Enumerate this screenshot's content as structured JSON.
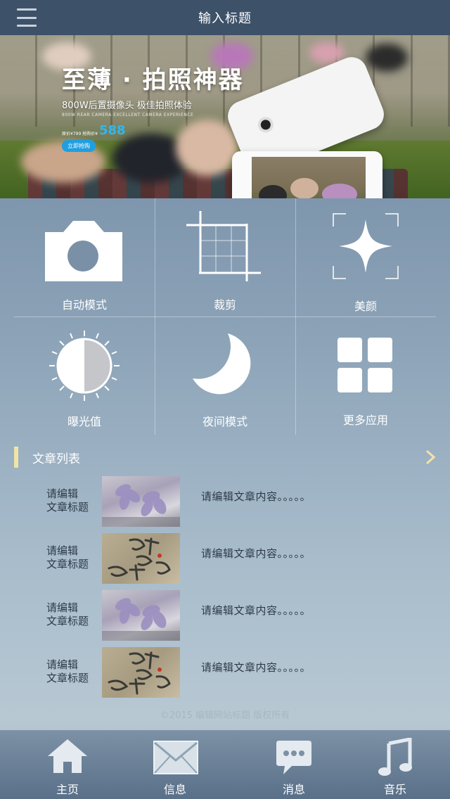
{
  "header": {
    "title": "输入标题",
    "menu_icon": "menu-icon"
  },
  "banner": {
    "headline": "至薄 · 拍照神器",
    "subline": "800W后置摄像头 极佳拍照体验",
    "subline_en": "800W REAR CAMERA EXCELLENT CAMERA EXPERIENCE",
    "price_note": "原价¥799 抢购价¥",
    "price": "588",
    "buy_label": "立即抢购",
    "accent_color": "#2fb7ee"
  },
  "grid": {
    "items": [
      {
        "label": "自动模式",
        "icon": "camera-icon"
      },
      {
        "label": "裁剪",
        "icon": "crop-icon"
      },
      {
        "label": "美颜",
        "icon": "sparkle-icon"
      },
      {
        "label": "曝光值",
        "icon": "exposure-icon"
      },
      {
        "label": "夜间模式",
        "icon": "moon-icon"
      },
      {
        "label": "更多应用",
        "icon": "apps-grid-icon"
      }
    ]
  },
  "articles": {
    "section_title": "文章列表",
    "accent_color": "#f2e3a6",
    "items": [
      {
        "title_line1": "请编辑",
        "title_line2": "文章标题",
        "content": "请编辑文章内容。。。。。",
        "thumb": "flower"
      },
      {
        "title_line1": "请编辑",
        "title_line2": "文章标题",
        "content": "请编辑文章内容。。。。。",
        "thumb": "calligraphy"
      },
      {
        "title_line1": "请编辑",
        "title_line2": "文章标题",
        "content": "请编辑文章内容。。。。。",
        "thumb": "flower"
      },
      {
        "title_line1": "请编辑",
        "title_line2": "文章标题",
        "content": "请编辑文章内容。。。。。",
        "thumb": "calligraphy"
      }
    ]
  },
  "footer": {
    "copyright": "©2015 编辑网站标题 版权所有"
  },
  "tabbar": {
    "tabs": [
      {
        "label": "主页",
        "icon": "home-icon"
      },
      {
        "label": "信息",
        "icon": "envelope-icon"
      },
      {
        "label": "消息",
        "icon": "chat-bubble-icon"
      },
      {
        "label": "音乐",
        "icon": "music-note-icon"
      }
    ]
  }
}
